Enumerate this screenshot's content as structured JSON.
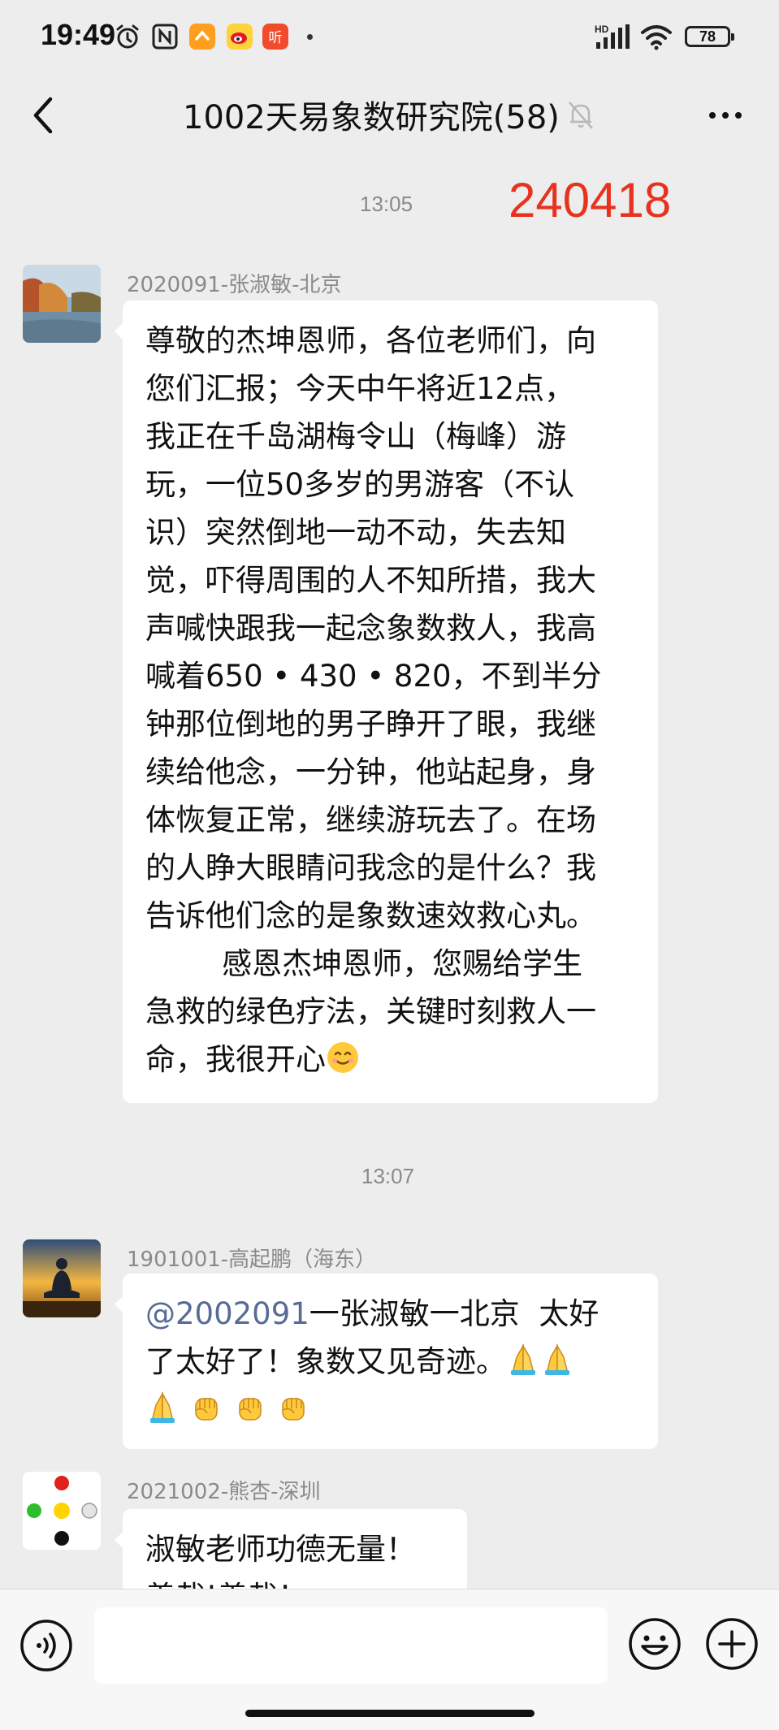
{
  "status_bar": {
    "time": "19:49",
    "battery": "78",
    "icons": [
      "alarm-icon",
      "nfc-icon",
      "app-icon-orange",
      "weibo-icon",
      "app-icon-red",
      "hd-signal-icon",
      "wifi-icon",
      "battery-icon"
    ]
  },
  "header": {
    "title": "1002天易象数研究院(58)",
    "icons": [
      "back-icon",
      "mute-bell-icon",
      "more-icon"
    ]
  },
  "annotation": "240418",
  "messages": [
    {
      "time": "13:05",
      "sender": "2020091-张淑敏-北京",
      "lines": [
        "尊敬的杰坤恩师，各位老师们，向",
        "您们汇报；今天中午将近12点，",
        "我正在千岛湖梅令山（梅峰）游",
        "玩，一位50多岁的男游客（不认",
        "识）突然倒地一动不动，失去知",
        "觉，吓得周围的人不知所措，我大",
        "声喊快跟我一起念象数救人，我高",
        "喊着650 • 430 • 820，不到半分",
        "钟那位倒地的男子睁开了眼，我继",
        "续给他念，一分钟，他站起身，身",
        "体恢复正常，继续游玩去了。在场",
        "的人睁大眼睛问我念的是什么？我",
        "告诉他们念的是象数速效救心丸。",
        "        感恩杰坤恩师，您赐给学生",
        "急救的绿色疗法，关键时刻救人一",
        "命，我很开心"
      ],
      "emoji": "smile-emoji"
    },
    {
      "time": "13:07",
      "sender": "1901001-高起鹏（海东）",
      "mention": "@2002091",
      "line1_rest": "一张淑敏一北京  太好",
      "line2": "了太好了！象数又见奇迹。",
      "emojis": [
        "pray-emoji",
        "pray-emoji",
        "pray-emoji",
        "fist-emoji",
        "fist-emoji",
        "fist-emoji"
      ]
    },
    {
      "sender": "2021002-熊杏-深圳",
      "line1": "淑敏老师功德无量！",
      "line2": "善哉!善哉！"
    }
  ],
  "colors": {
    "background": "#ededed",
    "bubble": "#ffffff",
    "mention": "#576b95",
    "annotation": "#e8321e"
  }
}
